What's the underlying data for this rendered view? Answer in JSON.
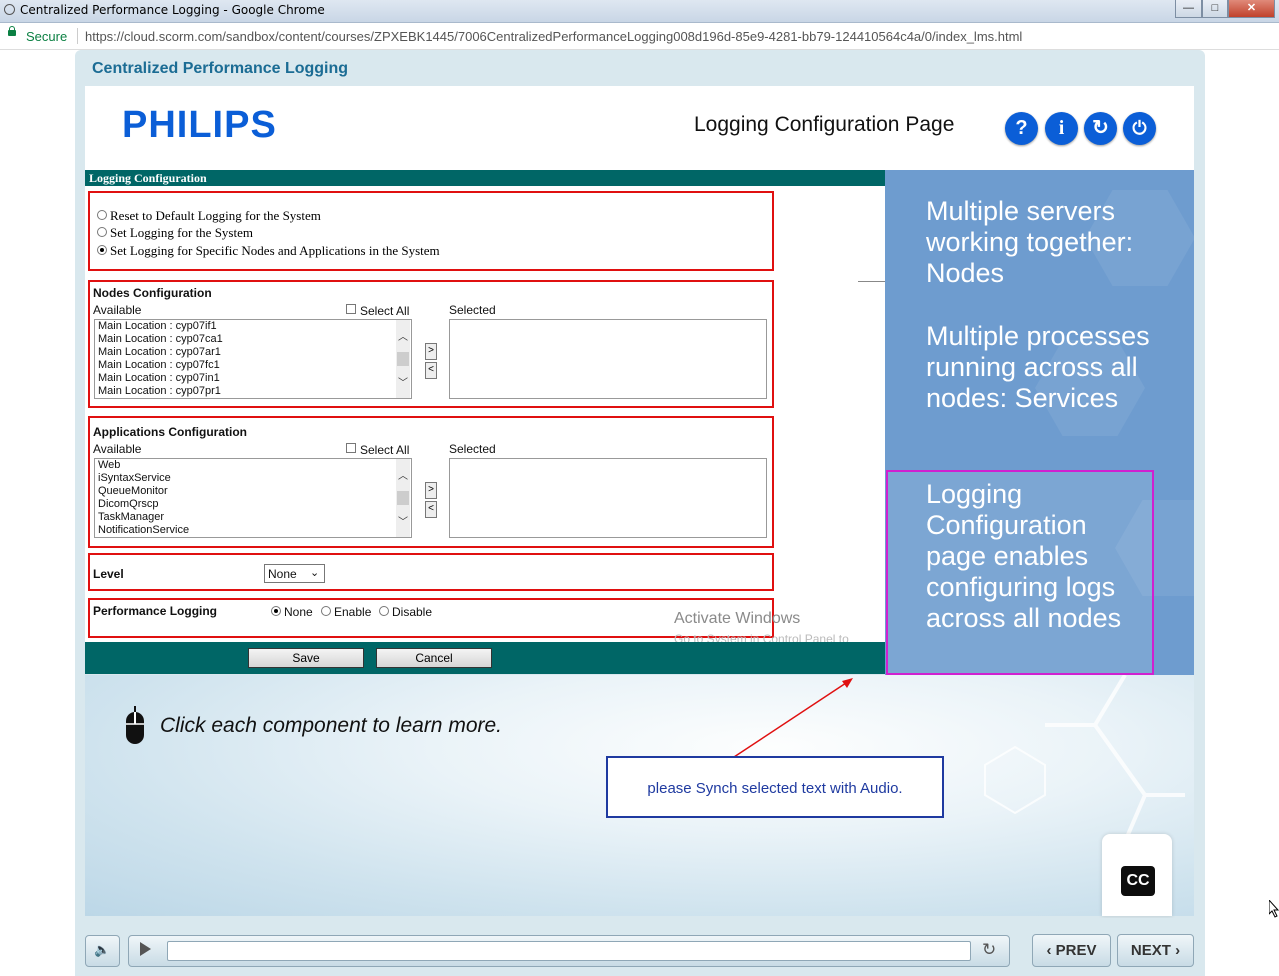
{
  "browser": {
    "window_title": "Centralized Performance Logging - Google Chrome",
    "minimize": "—",
    "maximize": "□",
    "close": "✕",
    "secure_label": "Secure",
    "url": "https://cloud.scorm.com/sandbox/content/courses/ZPXEBK1445/7006CentralizedPerformanceLogging008d196d-85e9-4281-bb79-124410564c4a/0/index_lms.html"
  },
  "course": {
    "title": "Centralized Performance Logging",
    "logo_text": "PHILIPS",
    "page_title": "Logging Configuration Page",
    "header_buttons": [
      {
        "name": "help-icon",
        "glyph": "?"
      },
      {
        "name": "info-icon",
        "glyph": "i"
      },
      {
        "name": "replay-icon",
        "glyph": "↻"
      },
      {
        "name": "power-icon",
        "glyph": "⏻"
      }
    ]
  },
  "form": {
    "title": "Logging Configuration",
    "radio_options": [
      {
        "label": "Reset to Default Logging for the System",
        "selected": false
      },
      {
        "label": "Set Logging for the System",
        "selected": false
      },
      {
        "label": "Set Logging for Specific Nodes and Applications in the System",
        "selected": true
      }
    ],
    "nodes": {
      "heading": "Nodes Configuration",
      "available_label": "Available",
      "select_all_label": "Select All",
      "selected_label": "Selected",
      "items": [
        "Main Location : cyp07if1",
        "Main Location : cyp07ca1",
        "Main Location : cyp07ar1",
        "Main Location : cyp07fc1",
        "Main Location : cyp07in1",
        "Main Location : cyp07pr1"
      ],
      "add_label": ">",
      "remove_label": "<"
    },
    "apps": {
      "heading": "Applications Configuration",
      "available_label": "Available",
      "select_all_label": "Select All",
      "selected_label": "Selected",
      "items": [
        "Web",
        "iSyntaxService",
        "QueueMonitor",
        "DicomQrscp",
        "TaskManager",
        "NotificationService"
      ],
      "add_label": ">",
      "remove_label": "<"
    },
    "level": {
      "label": "Level",
      "value": "None"
    },
    "perf": {
      "label": "Performance Logging",
      "options": [
        {
          "label": "None",
          "selected": true
        },
        {
          "label": "Enable",
          "selected": false
        },
        {
          "label": "Disable",
          "selected": false
        }
      ]
    },
    "save_label": "Save",
    "cancel_label": "Cancel",
    "watermark_title": "Activate Windows",
    "watermark_sub": "Go to System in Control Panel to activate Windows."
  },
  "info_panel": {
    "block1": "Multiple servers working together: Nodes",
    "block2": "Multiple processes running across all nodes: Services",
    "block3": "Logging Configuration page enables configuring logs across all nodes"
  },
  "slide": {
    "instruction": "Click each component to learn more.",
    "note": "please Synch selected text with Audio.",
    "cc_label": "CC"
  },
  "player": {
    "prev_label": "PREV",
    "next_label": "NEXT",
    "progress": 0
  },
  "colors": {
    "brand_blue": "#0b5ed7",
    "teal_bar": "#006666",
    "highlight_red": "#e01010",
    "highlight_magenta": "#d020d0",
    "panel_blue": "#6e9ccf"
  }
}
